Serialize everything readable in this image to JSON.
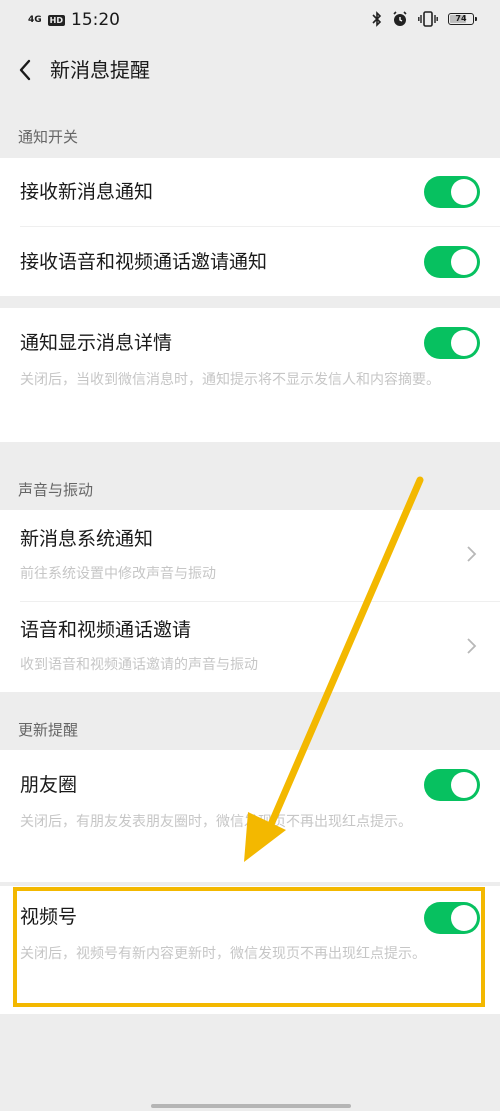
{
  "status_bar": {
    "signal": "4G",
    "hd": "HD",
    "time": "15:20",
    "battery_level": "74",
    "battery_fraction": 0.74
  },
  "nav": {
    "back_icon": "chevron-left-icon",
    "title": "新消息提醒"
  },
  "sections": {
    "notify": {
      "header": "通知开关",
      "receive_new_msg": {
        "title": "接收新消息通知",
        "enabled": true
      },
      "receive_call": {
        "title": "接收语音和视频通话邀请通知",
        "enabled": true
      },
      "show_details": {
        "title": "通知显示消息详情",
        "desc": "关闭后，当收到微信消息时，通知提示将不显示发信人和内容摘要。",
        "enabled": true
      }
    },
    "sound": {
      "header": "声音与振动",
      "system_notify": {
        "title": "新消息系统通知",
        "desc": "前往系统设置中修改声音与振动"
      },
      "call_invite": {
        "title": "语音和视频通话邀请",
        "desc": "收到语音和视频通话邀请的声音与振动"
      }
    },
    "updates": {
      "header": "更新提醒",
      "moments": {
        "title": "朋友圈",
        "desc": "关闭后，有朋友发表朋友圈时，微信发现页不再出现红点提示。",
        "enabled": true
      },
      "channels": {
        "title": "视频号",
        "desc": "关闭后，视频号有新内容更新时，微信发现页不再出现红点提示。",
        "enabled": true
      }
    }
  },
  "colors": {
    "toggle_on": "#07c160",
    "highlight": "#f3b800",
    "background": "#ededed"
  }
}
